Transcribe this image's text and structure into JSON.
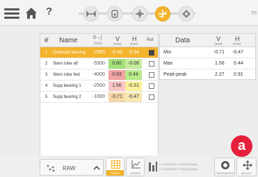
{
  "toolbar": {
    "help_label": "?",
    "partial_text": "m"
  },
  "table": {
    "headers": {
      "num": "#",
      "name": "Name",
      "col3": "0→|",
      "v": "V",
      "h": "H",
      "ref": "Ref"
    },
    "units": {
      "col3": "(mm)",
      "v": "(mm)",
      "h": "(mm)"
    },
    "rows": [
      {
        "num": "1",
        "name": "Outboard bearing",
        "pos": "-7000",
        "v": "-0.46",
        "h": "-0.34",
        "ref": true,
        "selected": true,
        "v_color": "#ffffff",
        "h_color": "#ffffff"
      },
      {
        "num": "2",
        "name": "Stern tube aft",
        "pos": "-5500",
        "v": "0.60",
        "h": "-0.06",
        "ref": false,
        "selected": false,
        "v_color": "#a6e07a",
        "h_color": "#c6ec9c"
      },
      {
        "num": "3",
        "name": "Stern tube fwd",
        "pos": "-4000",
        "v": "0.93",
        "h": "0.44",
        "ref": false,
        "selected": false,
        "v_color": "#f4a3a3",
        "h_color": "#b9ea8a"
      },
      {
        "num": "4",
        "name": "Supp bearing 1",
        "pos": "-2500",
        "v": "1.56",
        "h": "-0.31",
        "ref": false,
        "selected": false,
        "v_color": "#f9c5c5",
        "h_color": "#fbf19a"
      },
      {
        "num": "5",
        "name": "Supp bearing 2",
        "pos": "-1000",
        "v": "-0.71",
        "h": "-0.47",
        "ref": false,
        "selected": false,
        "v_color": "#f5d8a8",
        "h_color": "#f7e7b0"
      }
    ]
  },
  "stats": {
    "title": "Data",
    "v_header": "V",
    "h_header": "H",
    "unit": "(mm)",
    "rows": [
      {
        "label": "Min",
        "v": "-0.71",
        "h": "-0.47"
      },
      {
        "label": "Max",
        "v": "1.56",
        "h": "0.44"
      },
      {
        "label": "Peak-peak",
        "v": "2.27",
        "h": "0.91"
      }
    ]
  },
  "bottom": {
    "raw_label": "RAW",
    "table_label": "TABLE",
    "graph_label": "GRAPH",
    "readout1": "V: 0.70/0.20 H: 0.70/0.20 (mm)",
    "readout2": "V: 0.70/0.20 H: 0.70/0.20 (mm)",
    "tolerances_label": "TOLERANCES",
    "adjust_label": "ADJUST",
    "badge": "a"
  },
  "colors": {
    "accent": "#f4b32c",
    "badge": "#e61f3c"
  }
}
